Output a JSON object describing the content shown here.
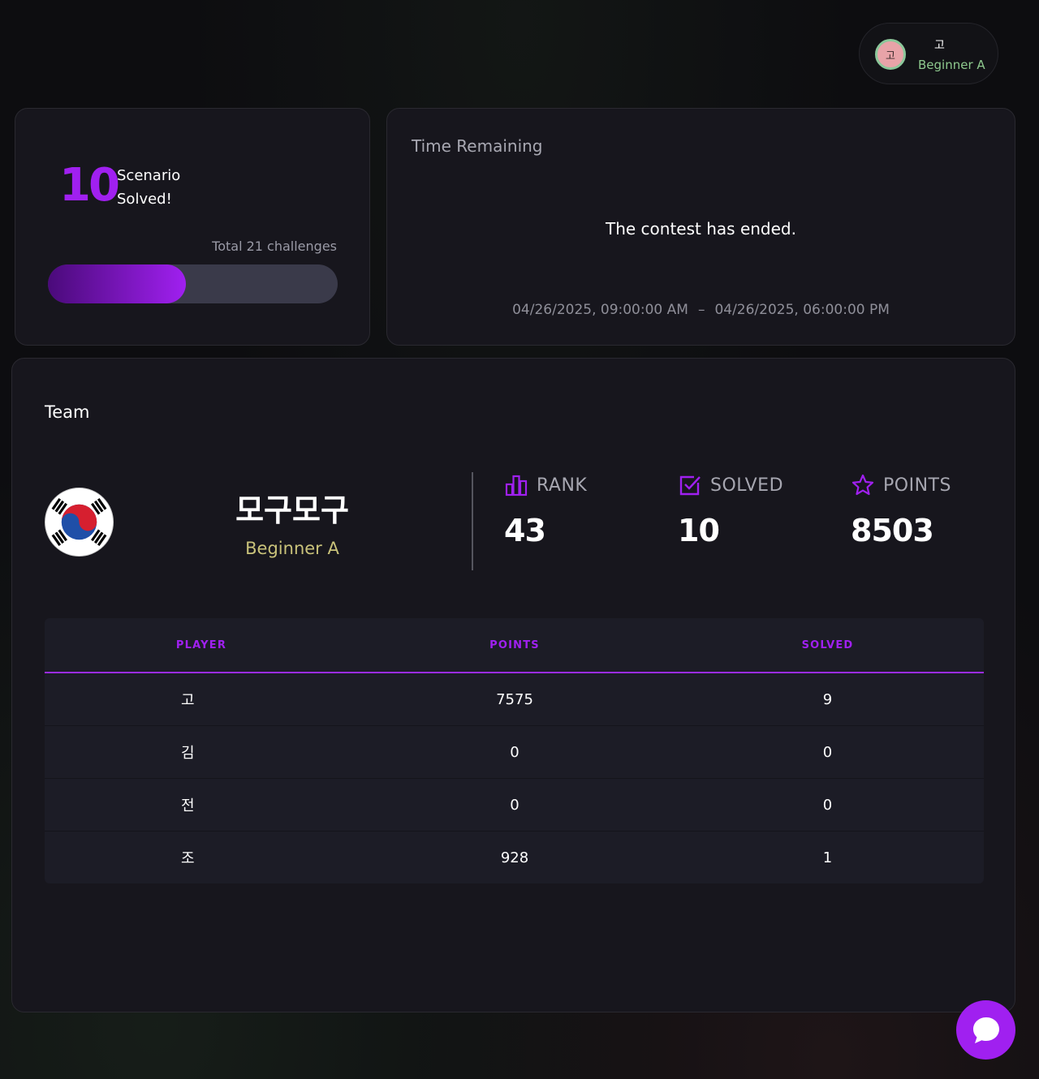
{
  "user": {
    "avatar_char": "고",
    "name": "고",
    "league": "Beginner A"
  },
  "scenario": {
    "solved_count": "10",
    "label_line1": "Scenario",
    "label_line2": "Solved!",
    "total_text": "Total 21 challenges",
    "progress_fraction": 0.476
  },
  "time": {
    "title": "Time Remaining",
    "message": "The contest has ended.",
    "start": "04/26/2025, 09:00:00 AM",
    "separator": "–",
    "end": "04/26/2025, 06:00:00 PM"
  },
  "team": {
    "section_title": "Team",
    "name": "모구모구",
    "league": "Beginner A",
    "flag_icon": "south-korea-flag-icon",
    "stats": {
      "rank_label": "RANK",
      "rank_value": "43",
      "solved_label": "SOLVED",
      "solved_value": "10",
      "points_label": "POINTS",
      "points_value": "8503"
    }
  },
  "table": {
    "headers": [
      "PLAYER",
      "POINTS",
      "SOLVED"
    ],
    "rows": [
      {
        "player": "고",
        "points": "7575",
        "solved": "9"
      },
      {
        "player": "김",
        "points": "0",
        "solved": "0"
      },
      {
        "player": "전",
        "points": "0",
        "solved": "0"
      },
      {
        "player": "조",
        "points": "928",
        "solved": "1"
      }
    ]
  },
  "colors": {
    "accent": "#a020f0",
    "league": "#c9c27a",
    "background": "#0d0d10",
    "card": "#17161d"
  },
  "chat": {
    "icon": "chat-bubble-icon"
  }
}
